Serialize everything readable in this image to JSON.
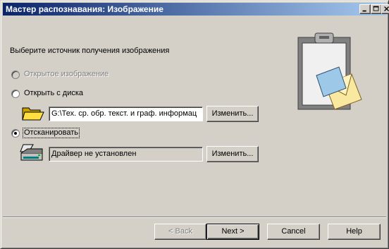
{
  "window": {
    "title": "Мастер распознавания: Изображение"
  },
  "content": {
    "prompt": "Выберите источник получения изображения",
    "options": {
      "open_image": {
        "label": "Открытое изображение",
        "enabled": false,
        "selected": false
      },
      "open_from_disk": {
        "label": "Открыть с диска",
        "enabled": true,
        "selected": false
      },
      "scan": {
        "label": "Отсканировать",
        "enabled": true,
        "selected": true
      }
    },
    "disk_path": "G:\\Тех. ср. обр. текст. и граф. информац",
    "disk_change_label": "Изменить...",
    "scanner_driver": "Драйвер не установлен",
    "scanner_change_label": "Изменить..."
  },
  "footer": {
    "back_label": "< Back",
    "next_label": "Next >",
    "cancel_label": "Cancel",
    "help_label": "Help"
  },
  "colors": {
    "title_gradient_start": "#0a246a",
    "title_gradient_end": "#a6caf0",
    "face": "#d4d0c8"
  }
}
